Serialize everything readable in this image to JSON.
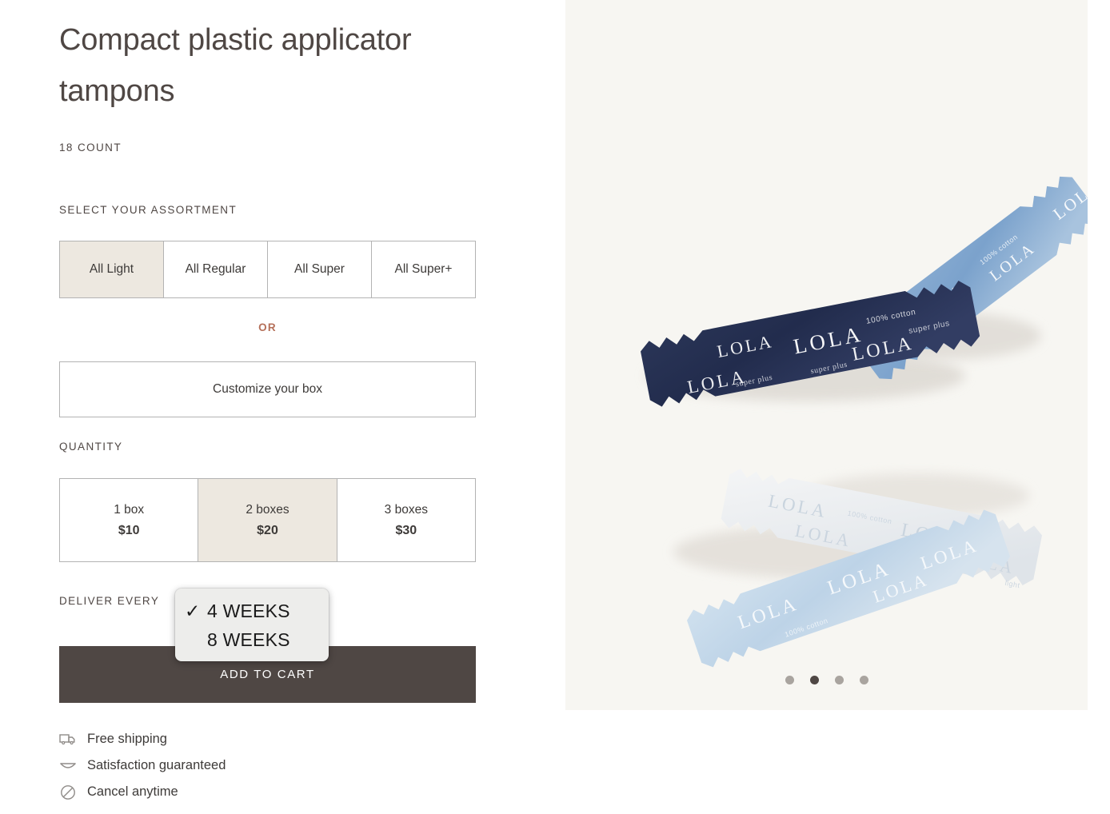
{
  "product": {
    "title": "Compact plastic applicator tampons",
    "count_label": "18 COUNT"
  },
  "assortment": {
    "label": "SELECT YOUR ASSORTMENT",
    "options": [
      {
        "label": "All Light",
        "selected": true
      },
      {
        "label": "All Regular",
        "selected": false
      },
      {
        "label": "All Super",
        "selected": false
      },
      {
        "label": "All Super+",
        "selected": false
      }
    ],
    "or_text": "OR",
    "customize_label": "Customize your box"
  },
  "quantity": {
    "label": "QUANTITY",
    "options": [
      {
        "name": "1 box",
        "price": "$10",
        "selected": false
      },
      {
        "name": "2 boxes",
        "price": "$20",
        "selected": true
      },
      {
        "name": "3 boxes",
        "price": "$30",
        "selected": false
      }
    ]
  },
  "delivery": {
    "label": "DELIVER EVERY",
    "selected_value": "4 WEEKS",
    "dropdown_open": true,
    "options": [
      {
        "label": "4 WEEKS",
        "checkmark": "✓",
        "selected": true
      },
      {
        "label": "8 WEEKS",
        "checkmark": "",
        "selected": false
      }
    ]
  },
  "cart": {
    "add_to_cart_label": "ADD TO CART"
  },
  "benefits": [
    {
      "icon": "truck-icon",
      "text": "Free shipping"
    },
    {
      "icon": "smile-icon",
      "text": "Satisfaction guaranteed"
    },
    {
      "icon": "no-entry-icon",
      "text": "Cancel anytime"
    }
  ],
  "gallery": {
    "alt": "Four LOLA-branded tampon wrappers arranged on a cream background",
    "wrapper_brand": "LOLA",
    "wrapper_notes": [
      "100% cotton",
      "super plus",
      "light"
    ],
    "dots": [
      {
        "active": false
      },
      {
        "active": true
      },
      {
        "active": false
      },
      {
        "active": false
      }
    ]
  },
  "colors": {
    "page_background": "#ffffff",
    "gallery_background": "#f7f6f2",
    "selected_swatch": "#ede8e0",
    "accent_or": "#b5705a",
    "button_dark": "#4f4744",
    "border_gray": "#b3b3b3",
    "dropdown_background": "#ededeb"
  }
}
